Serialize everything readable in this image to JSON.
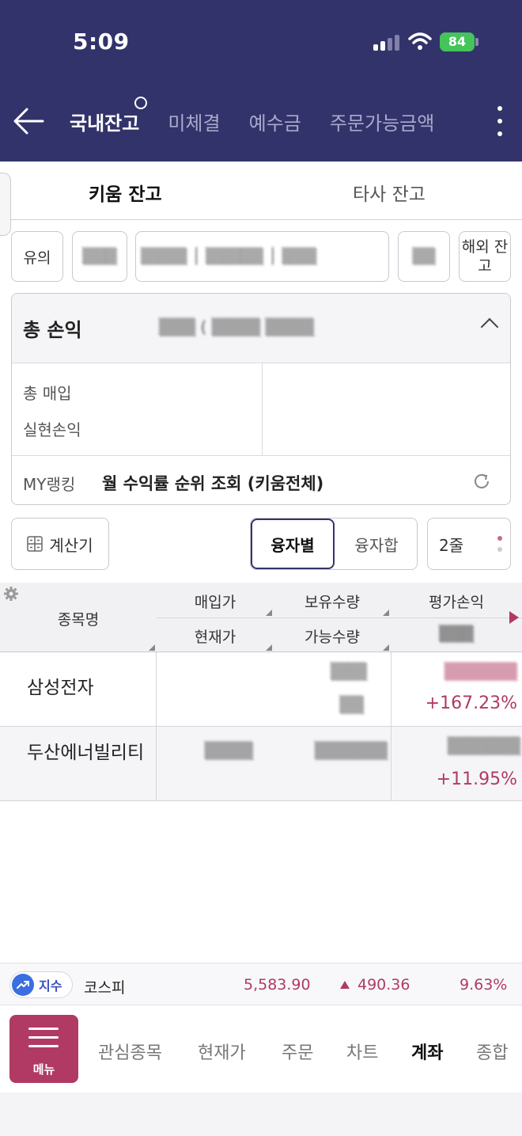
{
  "status_bar": {
    "time": "5:09",
    "battery": "84"
  },
  "header": {
    "tabs": [
      {
        "label": "국내잔고",
        "active": true
      },
      {
        "label": "미체결",
        "active": false
      },
      {
        "label": "예수금",
        "active": false
      },
      {
        "label": "주문가능금액",
        "active": false
      }
    ]
  },
  "sub_tabs": [
    {
      "label": "키움 잔고",
      "active": true
    },
    {
      "label": "타사 잔고",
      "active": false
    }
  ],
  "filters": {
    "warning": "유의",
    "overseas": "해외 잔고"
  },
  "summary": {
    "title": "총 손익",
    "total_buy_label": "총 매입",
    "realized_label": "실현손익",
    "rank_label": "MY랭킹",
    "rank_text": "월 수익률 순위 조회 (키움전체)"
  },
  "controls": {
    "calculator": "계산기",
    "by_loan": "융자별",
    "loan_sum": "융자합",
    "lines": "2줄"
  },
  "table": {
    "headers": {
      "name": "종목명",
      "buy_price": "매입가",
      "holding_qty": "보유수량",
      "eval_pl": "평가손익",
      "current_price": "현재가",
      "avail_qty": "가능수량"
    },
    "rows": [
      {
        "name": "삼성전자",
        "return_pct": "+167.23%"
      },
      {
        "name": "두산에너빌리티",
        "return_pct": "+11.95%"
      }
    ]
  },
  "ticker": {
    "badge": "지수",
    "name": "코스피",
    "value": "5,583.90",
    "change": "490.36",
    "change_pct": "9.63%"
  },
  "bottom_nav": {
    "menu": "메뉴",
    "items": [
      {
        "label": "관심종목",
        "active": false
      },
      {
        "label": "현재가",
        "active": false
      },
      {
        "label": "주문",
        "active": false
      },
      {
        "label": "차트",
        "active": false
      },
      {
        "label": "계좌",
        "active": true
      },
      {
        "label": "종합",
        "active": false
      }
    ]
  },
  "colors": {
    "navy": "#33336b",
    "accent": "#b03a64",
    "index_blue": "#3a6fe0"
  }
}
